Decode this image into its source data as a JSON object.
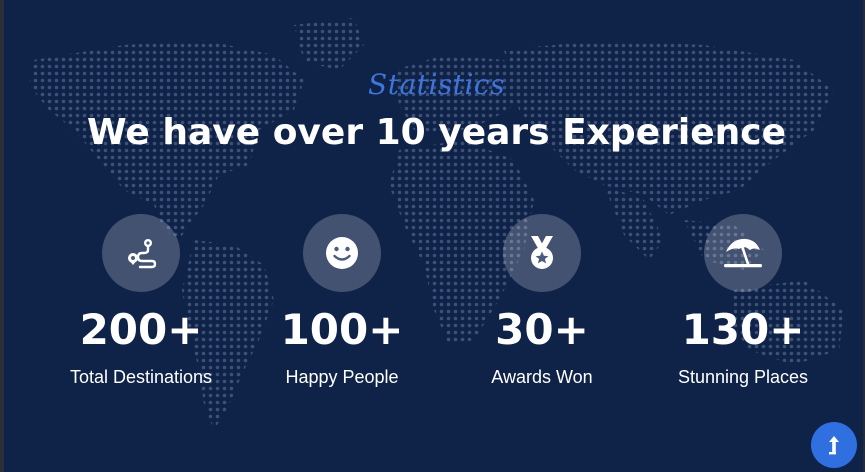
{
  "header": {
    "subtitle": "Statistics",
    "title": "We have over 10 years Experience"
  },
  "stats": [
    {
      "value": "200+",
      "label": "Total Destinations",
      "icon": "route-icon"
    },
    {
      "value": "100+",
      "label": "Happy People",
      "icon": "smile-icon"
    },
    {
      "value": "30+",
      "label": "Awards Won",
      "icon": "medal-icon"
    },
    {
      "value": "130+",
      "label": "Stunning Places",
      "icon": "beach-umbrella-icon"
    }
  ],
  "colors": {
    "background": "#0f2248",
    "accent": "#2f6fe0",
    "subtitle": "#3f74d8",
    "text": "#ffffff"
  }
}
